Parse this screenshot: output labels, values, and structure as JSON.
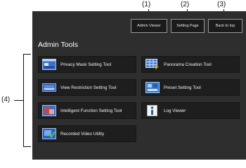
{
  "callouts": {
    "c1": "(1)",
    "c2": "(2)",
    "c3": "(3)",
    "c4": "(4)"
  },
  "header": {
    "admin_viewer": "Admin Viewer",
    "setting_page": "Setting Page",
    "back_to_top": "Back to top"
  },
  "section_title": "Admin Tools",
  "tools": [
    {
      "label": "Privacy Mask Setting Tool",
      "icon": "privacy-mask-icon"
    },
    {
      "label": "Panorama Creation Tool",
      "icon": "panorama-icon"
    },
    {
      "label": "View Restriction Setting Tool",
      "icon": "view-restriction-icon"
    },
    {
      "label": "Preset Setting Tool",
      "icon": "preset-icon"
    },
    {
      "label": "Intelligent Function Setting Tool",
      "icon": "intelligent-function-icon"
    },
    {
      "label": "Log Viewer",
      "icon": "log-viewer-icon"
    },
    {
      "label": "Recorded Video Utility",
      "icon": "recorded-video-icon"
    }
  ]
}
